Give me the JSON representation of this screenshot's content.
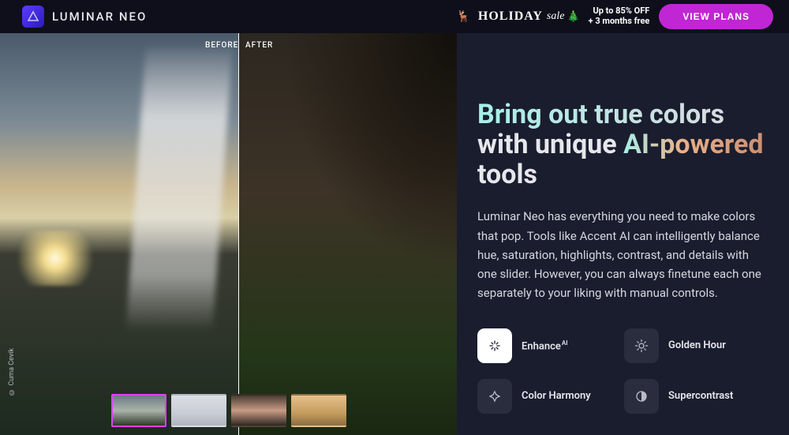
{
  "header": {
    "brand": "LUMINAR NEO",
    "promo_word_1": "HOLIDAY",
    "promo_word_2": "sale",
    "promo_line1": "Up to 85% OFF",
    "promo_line2": "+ 3 months free",
    "cta": "VIEW PLANS"
  },
  "compare": {
    "before_label": "BEFORE",
    "after_label": "AFTER",
    "credit": "© Cuma Cevik"
  },
  "content": {
    "headline_line1": "Bring out true colors",
    "headline_line2_a": "with unique ",
    "headline_line2_b": "AI-powered",
    "headline_line3": "tools",
    "body": "Luminar Neo has everything you need to make colors that pop. Tools like Accent AI can intelligently balance hue, saturation, highlights, contrast, and details with one slider. However, you can always finetune each one separately to your liking with manual controls."
  },
  "features": [
    {
      "label": "Enhance",
      "sup": "AI",
      "active": true
    },
    {
      "label": "Golden Hour",
      "sup": "",
      "active": false
    },
    {
      "label": "Color Harmony",
      "sup": "",
      "active": false
    },
    {
      "label": "Supercontrast",
      "sup": "",
      "active": false
    }
  ]
}
